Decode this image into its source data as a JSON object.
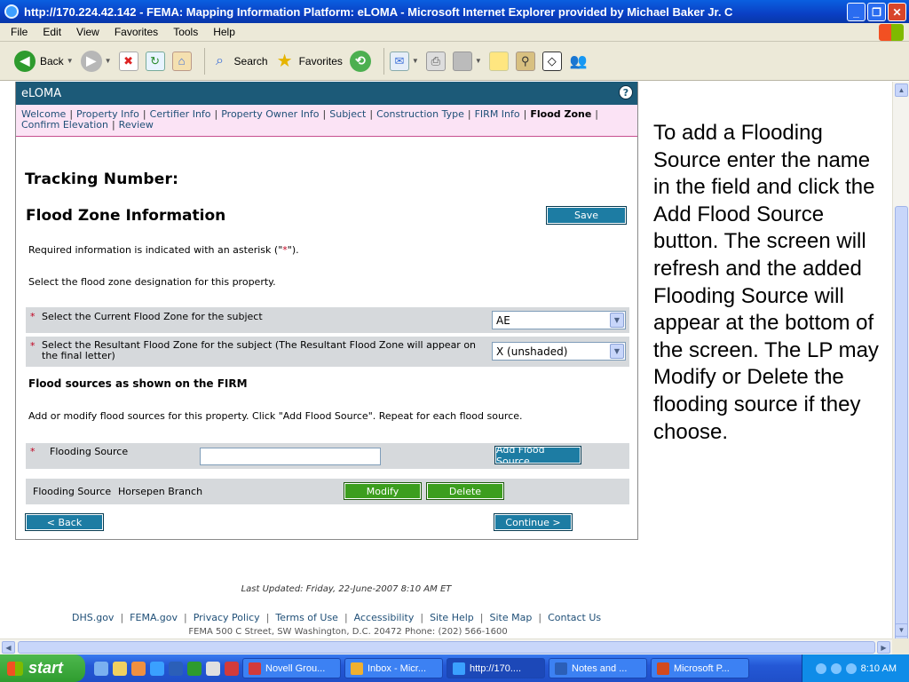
{
  "window": {
    "title": "http://170.224.42.142 - FEMA: Mapping Information Platform: eLOMA - Microsoft Internet Explorer provided by Michael Baker Jr. C"
  },
  "menu": [
    "File",
    "Edit",
    "View",
    "Favorites",
    "Tools",
    "Help"
  ],
  "toolbar": {
    "back": "Back",
    "search": "Search",
    "favorites": "Favorites"
  },
  "panel": {
    "title": "eLOMA",
    "nav": [
      {
        "label": "Welcome",
        "active": false
      },
      {
        "label": "Property Info",
        "active": false
      },
      {
        "label": "Certifier Info",
        "active": false
      },
      {
        "label": "Property Owner Info",
        "active": false
      },
      {
        "label": "Subject",
        "active": false
      },
      {
        "label": "Construction Type",
        "active": false
      },
      {
        "label": "FIRM Info",
        "active": false
      },
      {
        "label": "Flood Zone",
        "active": true
      },
      {
        "label": "Confirm Elevation",
        "active": false
      },
      {
        "label": "Review",
        "active": false
      }
    ],
    "tracking_label": "Tracking Number:",
    "section_title": "Flood Zone Information",
    "save_label": "Save",
    "required_note_before": "Required information is indicated with an asterisk (\"",
    "required_note_star": "*",
    "required_note_after": "\").",
    "select_note": "Select the flood zone designation for this property.",
    "current_zone_label": "Select the Current Flood Zone for the subject",
    "current_zone_value": "AE",
    "resultant_zone_label": "Select the Resultant Flood Zone for the subject (The Resultant Flood Zone will appear on the final letter)",
    "resultant_zone_value": "X (unshaded)",
    "sources_heading": "Flood sources as shown on the FIRM",
    "add_instructions": "Add or modify flood sources for this property. Click \"Add Flood Source\". Repeat for each flood source.",
    "flooding_source_label": "Flooding Source",
    "flooding_source_value": "",
    "add_source_label": "Add Flood Source",
    "existing_source_label": "Flooding Source",
    "existing_source_name": "Horsepen Branch",
    "modify_label": "Modify",
    "delete_label": "Delete",
    "back_label": "< Back",
    "continue_label": "Continue >",
    "asterisk": "*"
  },
  "annotation": "To add a Flooding Source enter the name in the field and click the Add Flood Source button. The screen will refresh and the added Flooding Source will appear at the bottom of the screen. The LP may Modify or Delete the flooding source if they choose.",
  "footer": {
    "last_updated": "Last Updated: Friday, 22-June-2007 8:10 AM ET",
    "links": [
      "DHS.gov",
      "FEMA.gov",
      "Privacy Policy",
      "Terms of Use",
      "Accessibility",
      "Site Help",
      "Site Map",
      "Contact Us"
    ],
    "address": "FEMA 500 C Street, SW Washington, D.C. 20472 Phone: (202) 566-1600"
  },
  "taskbar": {
    "start": "start",
    "tasks": [
      {
        "label": "Novell Grou...",
        "color": "#d23b3b",
        "active": false
      },
      {
        "label": "Inbox - Micr...",
        "color": "#f0b030",
        "active": false
      },
      {
        "label": "http://170....",
        "color": "#3aa0ff",
        "active": true
      },
      {
        "label": "Notes and ...",
        "color": "#2b5fb8",
        "active": false
      },
      {
        "label": "Microsoft P...",
        "color": "#d24a1e",
        "active": false
      }
    ],
    "clock": "8:10 AM"
  },
  "colors": {
    "panel_header": "#1c5a78",
    "nav_bg": "#fbe3f5",
    "primary_button": "#1d7ca3",
    "green_button": "#3c9e1e",
    "row_bg": "#d6d9dc",
    "asterisk": "#c0001f"
  },
  "icons": [
    "ie-icon",
    "back-icon",
    "forward-icon",
    "stop-icon",
    "refresh-icon",
    "home-icon",
    "search-icon",
    "favorites-star-icon",
    "history-icon",
    "mail-icon",
    "print-icon",
    "edit-icon",
    "discuss-icon",
    "research-icon",
    "messenger-icon",
    "help-icon",
    "windows-flag-icon"
  ]
}
